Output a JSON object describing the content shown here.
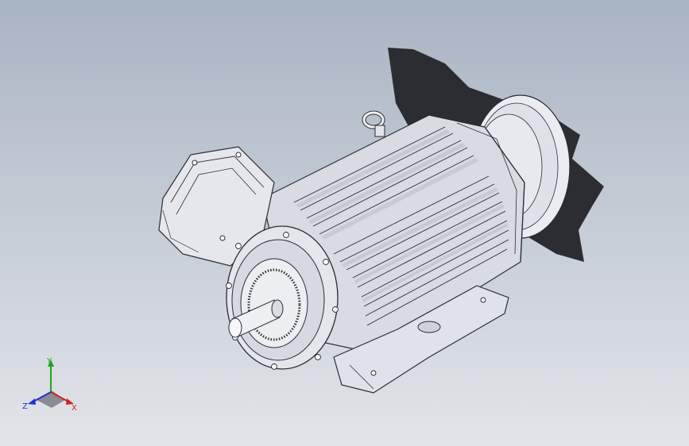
{
  "viewport": {
    "background_top": "#a9b4c3",
    "background_bottom": "#e2e5e9",
    "model": {
      "description_icon": "electric-motor-model",
      "body_color": "#e3e5ec",
      "line_color": "#2a2c34",
      "shadow_color": "#2b2d33"
    }
  },
  "triad": {
    "x_label": "X",
    "y_label": "Y",
    "z_label": "Z",
    "x_color": "#d42121",
    "y_color": "#1fa51f",
    "z_color": "#2430d0"
  }
}
